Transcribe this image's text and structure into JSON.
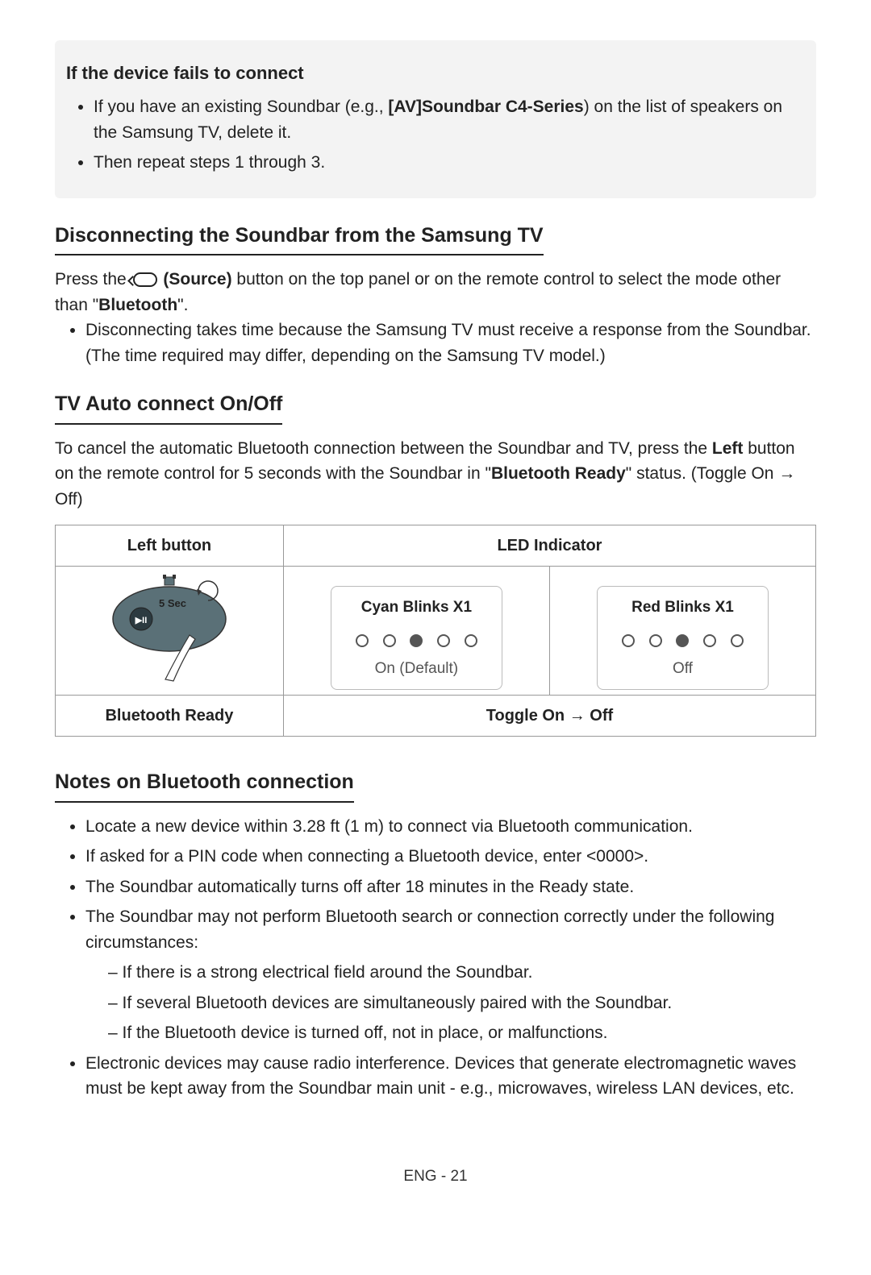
{
  "graybox": {
    "heading": "If the device fails to connect",
    "items": [
      {
        "pre": "If you have an existing Soundbar (e.g., ",
        "bold": "[AV]Soundbar C4-Series",
        "post": ") on the list of speakers on the Samsung TV, delete it."
      },
      {
        "pre": "Then repeat steps 1 through 3.",
        "bold": "",
        "post": ""
      }
    ]
  },
  "disconnect": {
    "heading": "Disconnecting the Soundbar from the Samsung TV",
    "p1_pre": "Press the ",
    "p1_source": " (Source)",
    "p1_post": " button on the top panel or on the remote control to select the mode other than \"",
    "p1_bt": "Bluetooth",
    "p1_end": "\".",
    "bullet": "Disconnecting takes time because the Samsung TV must receive a response from the Soundbar. (The time required may differ, depending on the Samsung TV model.)"
  },
  "autoconnect": {
    "heading": "TV Auto connect On/Off",
    "p_pre": "To cancel the automatic Bluetooth connection between the Soundbar and TV, press the ",
    "p_left": "Left",
    "p_mid": " button on the remote control for 5 seconds with the Soundbar in \"",
    "p_br": "Bluetooth Ready",
    "p_end": "\" status. (Toggle On → Off)"
  },
  "table": {
    "col1": "Left button",
    "col2": "LED Indicator",
    "fivesec": "5 Sec",
    "cyan": "Cyan Blinks X1",
    "on_default": "On (Default)",
    "red": "Red Blinks X1",
    "off": "Off",
    "row2_left": "Bluetooth Ready",
    "row2_right": "Toggle On → Off"
  },
  "notes": {
    "heading": "Notes on Bluetooth connection",
    "items": [
      "Locate a new device within 3.28 ft (1 m) to connect via Bluetooth communication.",
      "If asked for a PIN code when connecting a Bluetooth device, enter <0000>.",
      "The Soundbar automatically turns off after 18 minutes in the Ready state.",
      "The Soundbar may not perform Bluetooth search or connection correctly under the following circumstances:",
      "Electronic devices may cause radio interference. Devices that generate electromagnetic waves must be kept away from the Soundbar main unit - e.g., microwaves, wireless LAN devices, etc."
    ],
    "subitems": [
      "If there is a strong electrical field around the Soundbar.",
      "If several Bluetooth devices are simultaneously paired with the Soundbar.",
      "If the Bluetooth device is turned off, not in place, or malfunctions."
    ]
  },
  "footer": "ENG - 21"
}
